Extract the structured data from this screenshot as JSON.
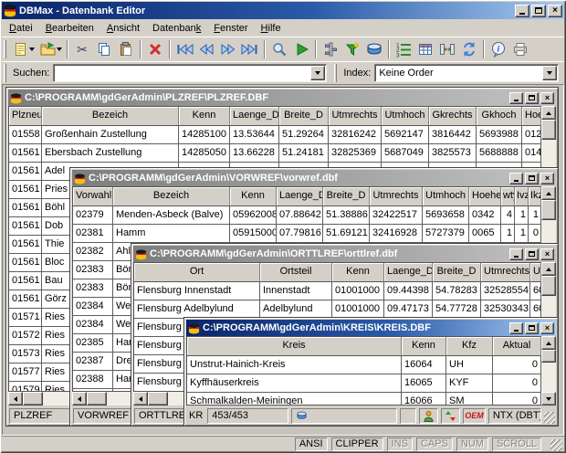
{
  "window": {
    "title": "DBMax - Datenbank Editor"
  },
  "menu": {
    "items": [
      {
        "label": "Datei",
        "accel": 0
      },
      {
        "label": "Bearbeiten",
        "accel": 0
      },
      {
        "label": "Ansicht",
        "accel": 0
      },
      {
        "label": "Datenbank",
        "accel": 8
      },
      {
        "label": "Fenster",
        "accel": 0
      },
      {
        "label": "Hilfe",
        "accel": 0
      }
    ]
  },
  "toolbar": {
    "icons": [
      "new-document",
      "open-folder",
      "cut",
      "copy",
      "paste",
      "delete",
      "go-first",
      "go-previous",
      "go-next",
      "go-last",
      "search",
      "run",
      "filter-settings",
      "filter",
      "database",
      "numbered-list",
      "table-columns",
      "column-width",
      "refresh",
      "info",
      "print"
    ]
  },
  "searchbar": {
    "label": "Suchen:",
    "value": "",
    "index_label": "Index:",
    "index_value": "Keine Order"
  },
  "tables": {
    "plzref": {
      "title": "C:\\PROGRAMM\\gdGerAdmin\\PLZREF\\PLZREF.DBF",
      "status_name": "PLZREF",
      "columns": [
        "Plzneu",
        "Bezeich",
        "Kenn",
        "Laenge_D",
        "Breite_D",
        "Utmrechts",
        "Utmhoch",
        "Gkrechts",
        "Gkhoch",
        "Hoe"
      ],
      "rows": [
        [
          "01558",
          "Großenhain Zustellung",
          "14285100",
          "13.53644",
          "51.29264",
          "32816242",
          "5692147",
          "3816442",
          "5693988",
          "012"
        ],
        [
          "01561",
          "Ebersbach Zustellung",
          "14285050",
          "13.66228",
          "51.24181",
          "32825369",
          "5687049",
          "3825573",
          "5688888",
          "014"
        ],
        [
          "01561",
          "Adel",
          "",
          "",
          "",
          "",
          "",
          "",
          "",
          ""
        ],
        [
          "01561",
          "Pries",
          "",
          "",
          "",
          "",
          "",
          "",
          "",
          ""
        ],
        [
          "01561",
          "Böhl",
          "",
          "",
          "",
          "",
          "",
          "",
          "",
          ""
        ],
        [
          "01561",
          "Dob",
          "",
          "",
          "",
          "",
          "",
          "",
          "",
          ""
        ],
        [
          "01561",
          "Thie",
          "",
          "",
          "",
          "",
          "",
          "",
          "",
          ""
        ],
        [
          "01561",
          "Bloc",
          "",
          "",
          "",
          "",
          "",
          "",
          "",
          ""
        ],
        [
          "01561",
          "Bau",
          "",
          "",
          "",
          "",
          "",
          "",
          "",
          ""
        ],
        [
          "01561",
          "Görz",
          "",
          "",
          "",
          "",
          "",
          "",
          "",
          ""
        ],
        [
          "01571",
          "Ries",
          "",
          "",
          "",
          "",
          "",
          "",
          "",
          ""
        ],
        [
          "01572",
          "Ries",
          "",
          "",
          "",
          "",
          "",
          "",
          "",
          ""
        ],
        [
          "01573",
          "Ries",
          "",
          "",
          "",
          "",
          "",
          "",
          "",
          ""
        ],
        [
          "01577",
          "Ries",
          "",
          "",
          "",
          "",
          "",
          "",
          "",
          ""
        ],
        [
          "01579",
          "Ries",
          "",
          "",
          "",
          "",
          "",
          "",
          "",
          ""
        ]
      ]
    },
    "vorwref": {
      "title": "C:\\PROGRAMM\\gdGerAdmin\\VORWREF\\vorwref.dbf",
      "status_name": "VORWREF",
      "columns": [
        "Vorwahl",
        "Bezeich",
        "Kenn",
        "Laenge_D",
        "Breite_D",
        "Utmrechts",
        "Utmhoch",
        "Hoehe",
        "wty",
        "Ivz",
        "Ikz"
      ],
      "rows": [
        [
          "02379",
          "Menden-Asbeck (Balve)",
          "05962008",
          "07.88642",
          "51.38886",
          "32422517",
          "5693658",
          "0342",
          "4",
          "1",
          "1"
        ],
        [
          "02381",
          "Hamm",
          "05915000",
          "07.79816",
          "51.69121",
          "32416928",
          "5727379",
          "0065",
          "1",
          "1",
          "0"
        ],
        [
          "02382",
          "Ahle",
          "",
          "",
          "",
          "",
          "",
          "",
          "",
          "",
          ""
        ],
        [
          "02383",
          "Bön",
          "",
          "",
          "",
          "",
          "",
          "",
          "",
          "",
          ""
        ],
        [
          "02383",
          "Bön",
          "",
          "",
          "",
          "",
          "",
          "",
          "",
          "",
          ""
        ],
        [
          "02384",
          "Wel",
          "",
          "",
          "",
          "",
          "",
          "",
          "",
          "",
          ""
        ],
        [
          "02384",
          "Wel",
          "",
          "",
          "",
          "",
          "",
          "",
          "",
          "",
          ""
        ],
        [
          "02385",
          "Ham",
          "",
          "",
          "",
          "",
          "",
          "",
          "",
          "",
          ""
        ],
        [
          "02387",
          "Dren",
          "",
          "",
          "",
          "",
          "",
          "",
          "",
          "",
          ""
        ],
        [
          "02388",
          "Ham",
          "",
          "",
          "",
          "",
          "",
          "",
          "",
          "",
          ""
        ],
        [
          "",
          "",
          "",
          "",
          "",
          "",
          "",
          "",
          "",
          "",
          ""
        ]
      ]
    },
    "orttlref": {
      "title": "C:\\PROGRAMM\\gdGerAdmin\\ORTTLREF\\orttlref.dbf",
      "status_name": "ORTTLREF",
      "columns": [
        "Ort",
        "Ortsteil",
        "Kenn",
        "Laenge_D",
        "Breite_D",
        "Utmrechts",
        "U"
      ],
      "rows": [
        [
          "Flensburg Innenstadt",
          "Innenstadt",
          "01001000",
          "09.44398",
          "54.78283",
          "32528554",
          "60"
        ],
        [
          "Flensburg Adelbylund",
          "Adelbylund",
          "01001000",
          "09.47173",
          "54.77728",
          "32530343",
          "60"
        ],
        [
          "Flensburg Al",
          "",
          "",
          "",
          "",
          "",
          ""
        ],
        [
          "Flensburg Du",
          "",
          "",
          "",
          "",
          "",
          ""
        ],
        [
          "Flensburg En",
          "",
          "",
          "",
          "",
          "",
          ""
        ],
        [
          "Flensburg Fr",
          "",
          "",
          "",
          "",
          "",
          ""
        ]
      ]
    },
    "kreis": {
      "title": "C:\\PROGRAMM\\gdGerAdmin\\KREIS\\KREIS.DBF",
      "columns": [
        "Kreis",
        "Kenn",
        "Kfz",
        "Aktual"
      ],
      "rows": [
        [
          "Unstrut-Hainich-Kreis",
          "16064",
          "UH",
          "0"
        ],
        [
          "Kyffhäuserkreis",
          "16065",
          "KYF",
          "0"
        ],
        [
          "Schmalkalden-Meiningen",
          "16066",
          "SM",
          "0"
        ]
      ],
      "status": {
        "prefix": "KR",
        "record": "453/453",
        "oem": "OEM",
        "format": "NTX (DBT)"
      }
    }
  },
  "statusbar": {
    "panels": [
      {
        "label": "ANSI",
        "enabled": true
      },
      {
        "label": "CLIPPER",
        "enabled": true
      },
      {
        "label": "INS",
        "enabled": false
      },
      {
        "label": "CAPS",
        "enabled": false
      },
      {
        "label": "NUM",
        "enabled": false
      },
      {
        "label": "SCROLL",
        "enabled": false
      }
    ]
  },
  "colors": {
    "title_active_from": "#0a246a",
    "title_active_to": "#a6caf0",
    "title_inactive_from": "#7d7d7d",
    "title_inactive_to": "#c2c2c2",
    "chrome": "#d4d0c8",
    "grid_line": "#5e5e5e"
  }
}
